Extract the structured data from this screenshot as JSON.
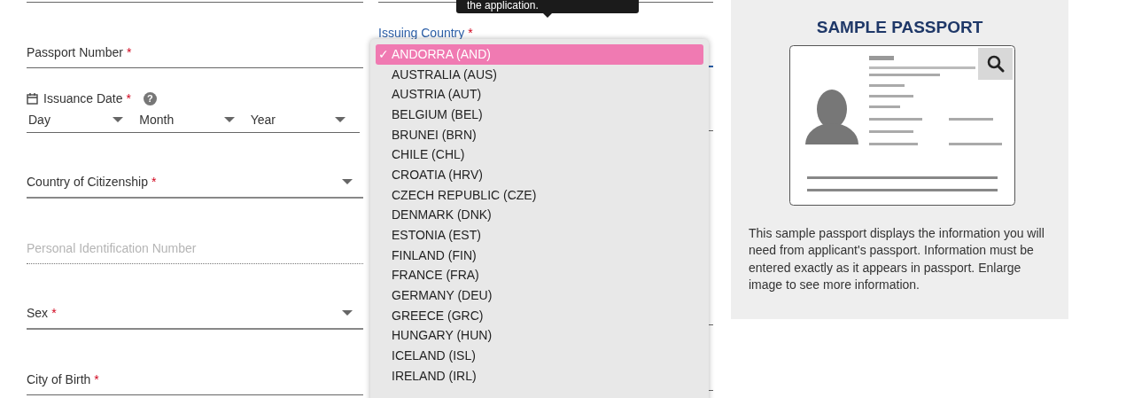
{
  "tooltip": {
    "text": "the application."
  },
  "required_mark": "*",
  "help_mark": "?",
  "check_mark": "✓",
  "left_fields": [
    {
      "kind": "text",
      "label": "Passport Number",
      "required": true
    },
    {
      "kind": "date",
      "label": "Issuance Date",
      "required": true,
      "parts": [
        {
          "placeholder": "Day"
        },
        {
          "placeholder": "Month"
        },
        {
          "placeholder": "Year"
        }
      ]
    },
    {
      "kind": "select",
      "label": "Country of Citizenship",
      "required": true
    },
    {
      "kind": "disabled",
      "placeholder": "Personal Identification Number"
    },
    {
      "kind": "select",
      "label": "Sex",
      "required": true
    },
    {
      "kind": "text",
      "label": "City of Birth",
      "required": true
    }
  ],
  "issuing_country": {
    "label": "Issuing Country",
    "required": true,
    "options": [
      {
        "label": "ANDORRA (AND)",
        "selected": true
      },
      {
        "label": "AUSTRALIA (AUS)",
        "selected": false
      },
      {
        "label": "AUSTRIA (AUT)",
        "selected": false
      },
      {
        "label": "BELGIUM (BEL)",
        "selected": false
      },
      {
        "label": "BRUNEI (BRN)",
        "selected": false
      },
      {
        "label": "CHILE (CHL)",
        "selected": false
      },
      {
        "label": "CROATIA (HRV)",
        "selected": false
      },
      {
        "label": "CZECH REPUBLIC (CZE)",
        "selected": false
      },
      {
        "label": "DENMARK (DNK)",
        "selected": false
      },
      {
        "label": "ESTONIA (EST)",
        "selected": false
      },
      {
        "label": "FINLAND (FIN)",
        "selected": false
      },
      {
        "label": "FRANCE (FRA)",
        "selected": false
      },
      {
        "label": "GERMANY (DEU)",
        "selected": false
      },
      {
        "label": "GREECE (GRC)",
        "selected": false
      },
      {
        "label": "HUNGARY (HUN)",
        "selected": false
      },
      {
        "label": "ICELAND (ISL)",
        "selected": false
      },
      {
        "label": "IRELAND (IRL)",
        "selected": false
      }
    ]
  },
  "sample_panel": {
    "title": "SAMPLE PASSPORT",
    "description": "This sample passport displays the information you will need from applicant's passport. Information must be entered exactly as it appears in passport. Enlarge image to see more information."
  }
}
